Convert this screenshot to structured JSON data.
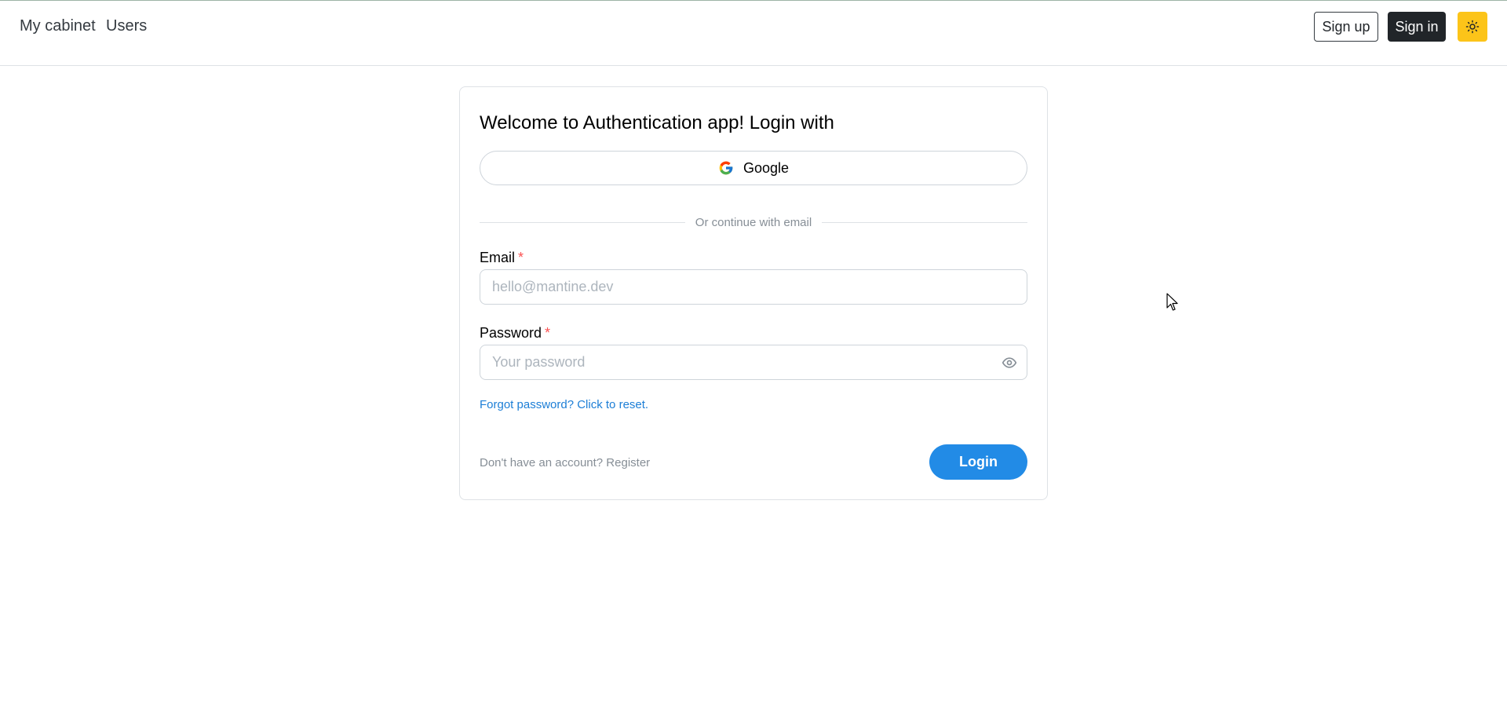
{
  "header": {
    "nav": [
      "My cabinet",
      "Users"
    ],
    "signup_label": "Sign up",
    "signin_label": "Sign in",
    "theme_icon": "sun-icon",
    "theme_color": "#fcc419"
  },
  "card": {
    "title": "Welcome to Authentication app! Login with",
    "google_label": "Google",
    "divider_label": "Or continue with email",
    "email_label": "Email",
    "email_placeholder": "hello@mantine.dev",
    "email_value": "",
    "password_label": "Password",
    "password_placeholder": "Your password",
    "password_value": "",
    "required_mark": "*",
    "forgot_label": "Forgot password? Click to reset.",
    "register_label": "Don't have an account? Register",
    "login_label": "Login"
  },
  "colors": {
    "accent": "#228be6",
    "link": "#1c7ed6",
    "required": "#fa5252",
    "dark_button": "#212529"
  }
}
